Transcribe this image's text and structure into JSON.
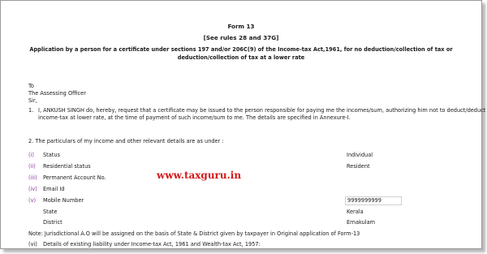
{
  "form": {
    "title": "Form 13",
    "rules": "[See rules 28 and 37G]",
    "heading_line1": "Application by a person for a certificate under sections 197 and/or 206C(9) of the Income-tax Act,1961, for no deduction/collection of tax or",
    "heading_line2": "deduction/collection of tax at a lower rate"
  },
  "address": {
    "to": "To",
    "officer": "The Assessing Officer",
    "salutation": "Sir,"
  },
  "para1": {
    "number": "1.",
    "line1": "I, ANKUSH SINGH do, hereby, request that a certificate may be issued to the person responsible for paying me the incomes/sum, authorizing him not to deduct/deduct",
    "line2": "income-tax at lower rate, at the time of payment of such income/sum to me. The details are specified in Annexure-I."
  },
  "para2": {
    "intro": "2. The particulars of my income and other relevant details are as under :"
  },
  "particulars": [
    {
      "num": "(i)",
      "label": "Status",
      "value": "Individual"
    },
    {
      "num": "(ii)",
      "label": "Residential status",
      "value": "Resident"
    },
    {
      "num": "(iii)",
      "label": "Permanent Account No.",
      "value": ""
    },
    {
      "num": "(iv)",
      "label": "Email Id",
      "value": ""
    },
    {
      "num": "(v)",
      "label": "Mobile Number",
      "value": "9999999999"
    }
  ],
  "location": {
    "state_label": "State",
    "state_value": "Kerala",
    "district_label": "District",
    "district_value": "Ernakulam"
  },
  "note": "Note: Jurisdictional A.O will be assigned on the basis of State & District given by taxpayer in Original application of Form-13",
  "item_vi": {
    "num": "(vi)",
    "label": "Details of existing liability under Income-tax Act, 1961 and Wealth-tax Act, 1957:"
  },
  "watermark": "www.taxguru.in",
  "colors": {
    "numeral": "#8a3a9a",
    "watermark": "#d51818"
  }
}
